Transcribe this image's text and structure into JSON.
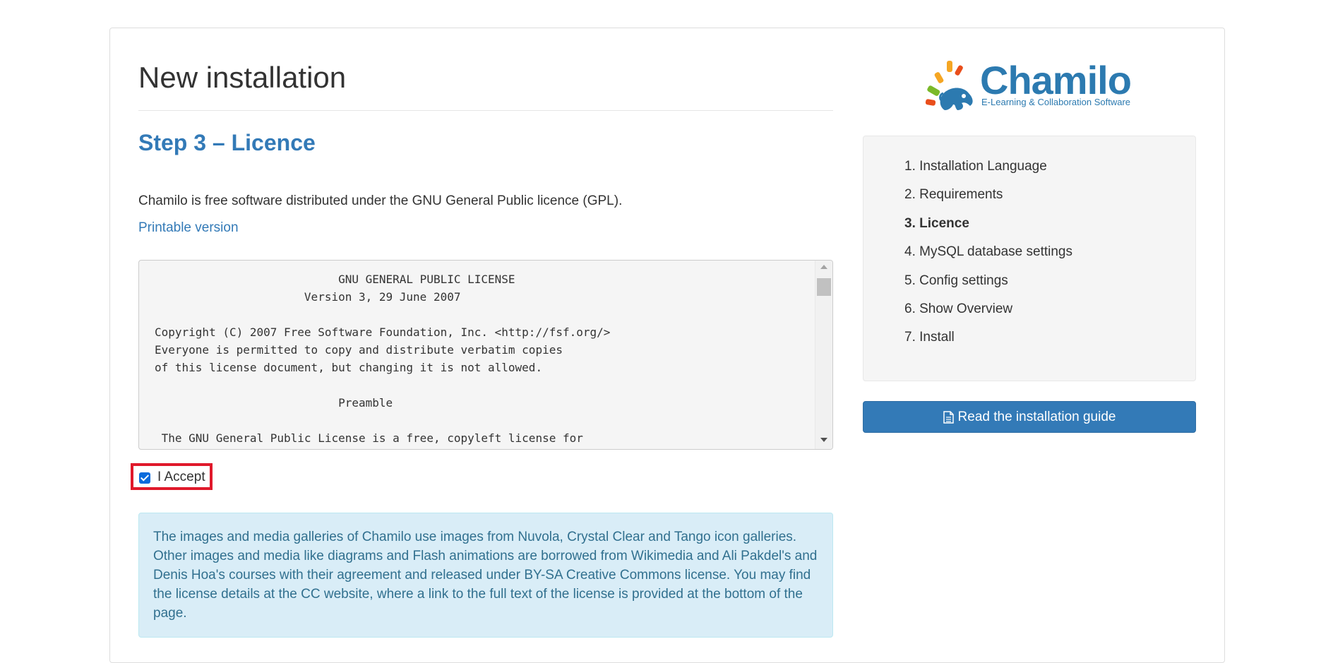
{
  "header": {
    "title": "New installation",
    "step_title": "Step 3 – Licence"
  },
  "intro": {
    "text": "Chamilo is free software distributed under the GNU General Public licence (GPL).",
    "printable_link": "Printable version"
  },
  "license_text": "                           GNU GENERAL PUBLIC LICENSE\n                      Version 3, 29 June 2007\n\nCopyright (C) 2007 Free Software Foundation, Inc. <http://fsf.org/>\nEveryone is permitted to copy and distribute verbatim copies\nof this license document, but changing it is not allowed.\n\n                           Preamble\n\n The GNU General Public License is a free, copyleft license for",
  "accept": {
    "label": "I Accept",
    "checked": true
  },
  "info": {
    "text_before": "The images and media galleries of Chamilo use images from Nuvola, Crystal Clear and Tango icon galleries. Other images and media like diagrams and Flash animations are borrowed from Wikimedia and Ali Pakdel's and Denis Hoa's courses with their agreement and released under BY-SA Creative Commons license. You may find the license details at ",
    "link": "the CC website",
    "text_after": ", where a link to the full text of the license is provided at the bottom of the page."
  },
  "logo": {
    "wordmark": "Chamilo",
    "tagline": "E-Learning & Collaboration Software",
    "colors": [
      "#f5a623",
      "#e94e1b",
      "#7ab929",
      "#2c7ab0"
    ]
  },
  "steps": [
    {
      "label": "1. Installation Language",
      "active": false
    },
    {
      "label": "2. Requirements",
      "active": false
    },
    {
      "label": "3. Licence",
      "active": true
    },
    {
      "label": "4. MySQL database settings",
      "active": false
    },
    {
      "label": "5. Config settings",
      "active": false
    },
    {
      "label": "6. Show Overview",
      "active": false
    },
    {
      "label": "7. Install",
      "active": false
    }
  ],
  "guide_button": {
    "label": "Read the installation guide",
    "icon": "file-text-icon"
  },
  "colors": {
    "primary": "#337ab7",
    "info_bg": "#d9edf7",
    "info_text": "#31708f",
    "highlight": "#e0192b"
  }
}
